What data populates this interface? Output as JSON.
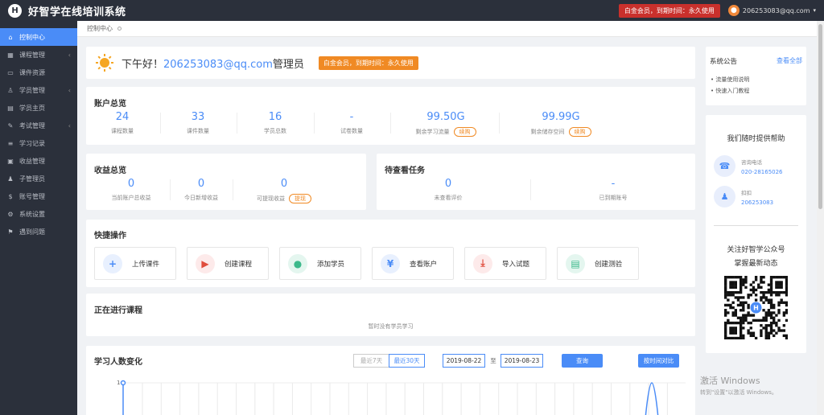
{
  "app": {
    "logo_letter": "H",
    "title": "好智学在线培训系统"
  },
  "header": {
    "vip_text": "白金会员，到期时间：永久使用",
    "user_email": "206253083@qq.com"
  },
  "sidebar": {
    "items": [
      {
        "label": "控制中心",
        "icon": "home-icon",
        "active": true
      },
      {
        "label": "课程管理",
        "icon": "grid-icon",
        "arrow": true
      },
      {
        "label": "课件资源",
        "icon": "folder-icon"
      },
      {
        "label": "学员管理",
        "icon": "user-icon",
        "arrow": true
      },
      {
        "label": "学员主页",
        "icon": "profile-icon"
      },
      {
        "label": "考试管理",
        "icon": "pencil-icon",
        "arrow": true
      },
      {
        "label": "学习记录",
        "icon": "list-icon"
      },
      {
        "label": "收益管理",
        "icon": "wallet-icon"
      },
      {
        "label": "子管理员",
        "icon": "admin-icon"
      },
      {
        "label": "账号管理",
        "icon": "dollar-icon"
      },
      {
        "label": "系统设置",
        "icon": "gear-icon"
      },
      {
        "label": "遇到问题",
        "icon": "help-icon"
      }
    ]
  },
  "breadcrumb": {
    "current": "控制中心"
  },
  "greeting": {
    "prefix": "下午好！",
    "email": "206253083@qq.com",
    "role": "管理员",
    "badge": "白金会员，到期时间：永久使用"
  },
  "account": {
    "title": "账户总览",
    "renew_label": "续购",
    "stats": [
      {
        "value": "24",
        "label": "课程数量"
      },
      {
        "value": "33",
        "label": "课件数量"
      },
      {
        "value": "16",
        "label": "学员总数"
      },
      {
        "value": "-",
        "label": "试卷数量"
      },
      {
        "value": "99.50G",
        "label": "剩余学习流量",
        "renew": true
      },
      {
        "value": "99.99G",
        "label": "剩余储存空间",
        "renew": true
      }
    ]
  },
  "income": {
    "title": "收益总览",
    "withdraw_label": "提现",
    "stats": [
      {
        "value": "0",
        "label": "当前账户总收益"
      },
      {
        "value": "0",
        "label": "今日新增收益"
      },
      {
        "value": "0",
        "label": "可提现收益",
        "withdraw": true
      }
    ]
  },
  "tasks": {
    "title": "待查看任务",
    "stats": [
      {
        "value": "0",
        "label": "未查看评价"
      },
      {
        "value": "-",
        "label": "已到期账号"
      }
    ]
  },
  "quick": {
    "title": "快捷操作",
    "buttons": [
      {
        "label": "上传课件",
        "icon": "plus-icon",
        "glyph": "+",
        "color": "#4a8cf7",
        "bg": "#e8f0fe"
      },
      {
        "label": "创建课程",
        "icon": "video-icon",
        "glyph": "▶",
        "color": "#e04c3c",
        "bg": "#fdeaea"
      },
      {
        "label": "添加学员",
        "icon": "user-add-icon",
        "glyph": "●",
        "color": "#3cb98b",
        "bg": "#e4f6ef"
      },
      {
        "label": "查看账户",
        "icon": "yuan-icon",
        "glyph": "¥",
        "color": "#4a8cf7",
        "bg": "#e8f0fe"
      },
      {
        "label": "导入试题",
        "icon": "download-icon",
        "glyph": "⤓",
        "color": "#e04c3c",
        "bg": "#fdeaea"
      },
      {
        "label": "创建测验",
        "icon": "document-icon",
        "glyph": "▤",
        "color": "#3cb98b",
        "bg": "#e4f6ef"
      }
    ]
  },
  "ongoing": {
    "title": "正在进行课程",
    "empty": "暂时没有学员学习"
  },
  "trend": {
    "title": "学习人数变化",
    "seg_7": "最近7天",
    "seg_30": "最近30天",
    "date_from": "2019-08-22",
    "date_sep": "至",
    "date_to": "2019-08-23",
    "query": "查询",
    "compare": "按时间对比",
    "y_tick": "1"
  },
  "notice": {
    "title": "系统公告",
    "view_all": "查看全部",
    "items": [
      "流量使用说明",
      "快速入门教程"
    ]
  },
  "help": {
    "title": "我们随时提供帮助",
    "phone_label": "咨询电话",
    "phone": "020-28165026",
    "qq_label": "扣扣",
    "qq": "206253083",
    "follow1": "关注好智学公众号",
    "follow2": "掌握最新动态"
  },
  "watermark": {
    "line1": "激活 Windows",
    "line2": "转到\"设置\"以激活 Windows。"
  }
}
